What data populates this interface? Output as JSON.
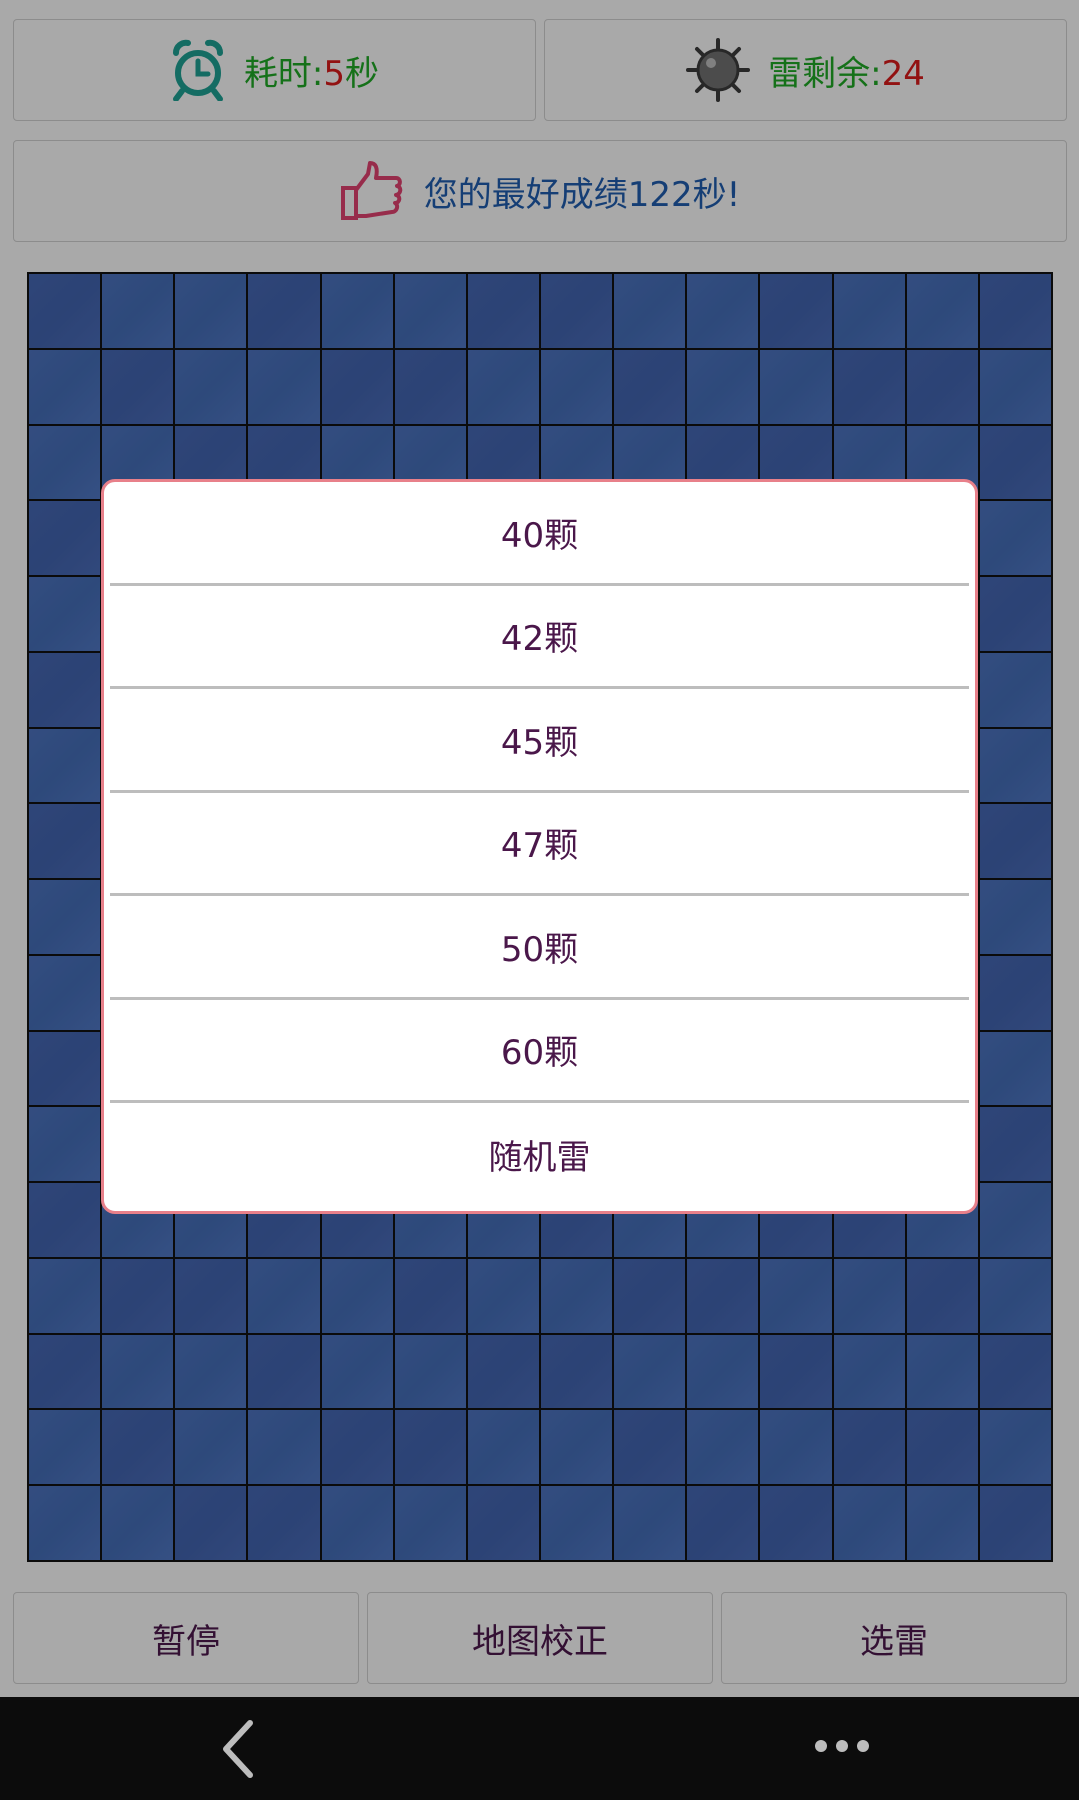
{
  "header": {
    "timer_label": "耗时:",
    "timer_value": "5",
    "timer_unit": "秒",
    "mines_label": "雷剩余:",
    "mines_value": "24",
    "best_score": "您的最好成绩122秒!"
  },
  "icons": {
    "timer": "alarm-clock-icon",
    "mines": "mine-icon",
    "best": "thumbs-up-icon",
    "back": "back-icon",
    "more": "more-icon"
  },
  "colors": {
    "label_green": "#1fa224",
    "value_red": "#d21a1a",
    "best_blue": "#1f5aa8",
    "cell_blue": "#4a6fb8",
    "dialog_border": "#e8808a",
    "button_text": "#4a174a"
  },
  "board": {
    "columns": 14,
    "rows": 17
  },
  "dialog": {
    "options": [
      "40颗",
      "42颗",
      "45颗",
      "47颗",
      "50颗",
      "60颗",
      "随机雷"
    ]
  },
  "buttons": {
    "pause": "暂停",
    "map_fix": "地图校正",
    "select_mines": "选雷"
  }
}
